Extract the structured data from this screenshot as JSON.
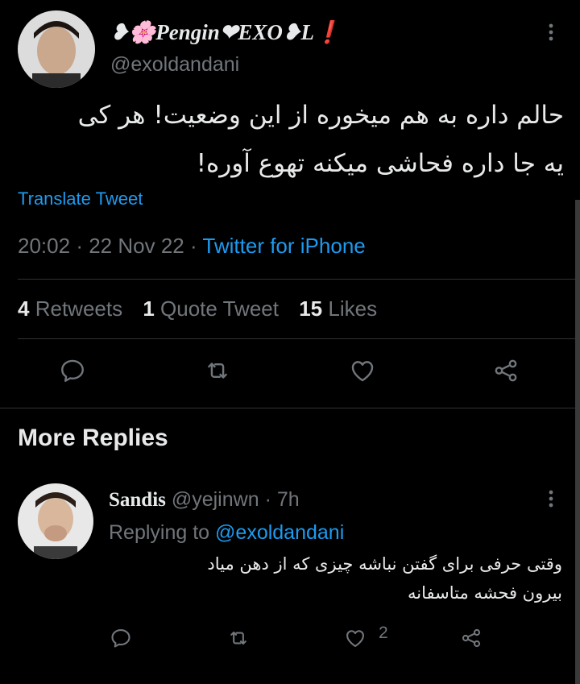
{
  "tweet": {
    "author_name": "❥🌸Pengin❤EXO❥L❗",
    "author_handle": "@exoldandani",
    "text_line1": "حالم داره به هم میخوره از این وضعیت! هر کی",
    "text_line2": "یه جا داره فحاشی میکنه تهوع آوره!",
    "translate_label": "Translate Tweet",
    "time": "20:02",
    "date": "22 Nov 22",
    "separator": "·",
    "source": "Twitter for iPhone",
    "retweets_count": "4",
    "retweets_label": "Retweets",
    "quotes_count": "1",
    "quotes_label": "Quote Tweet",
    "likes_count": "15",
    "likes_label": "Likes"
  },
  "section": {
    "title": "More Replies"
  },
  "reply": {
    "author_name": "Sandis",
    "author_handle": "@yejinwn",
    "separator": "·",
    "time_ago": "7h",
    "replying_prefix": "Replying to",
    "replying_to": "@exoldandani",
    "text_line1": "وقتی حرفی برای گفتن نباشه چیزی که از دهن میاد",
    "text_line2": "بیرون فحشه متاسفانه",
    "like_count": "2"
  },
  "colors": {
    "background": "#000000",
    "accent": "#1d9bf0",
    "muted": "#71767b",
    "text": "#e7e9ea",
    "divider": "#2f3336"
  },
  "icons": [
    "more-icon",
    "reply-icon",
    "retweet-icon",
    "like-icon",
    "share-icon"
  ]
}
